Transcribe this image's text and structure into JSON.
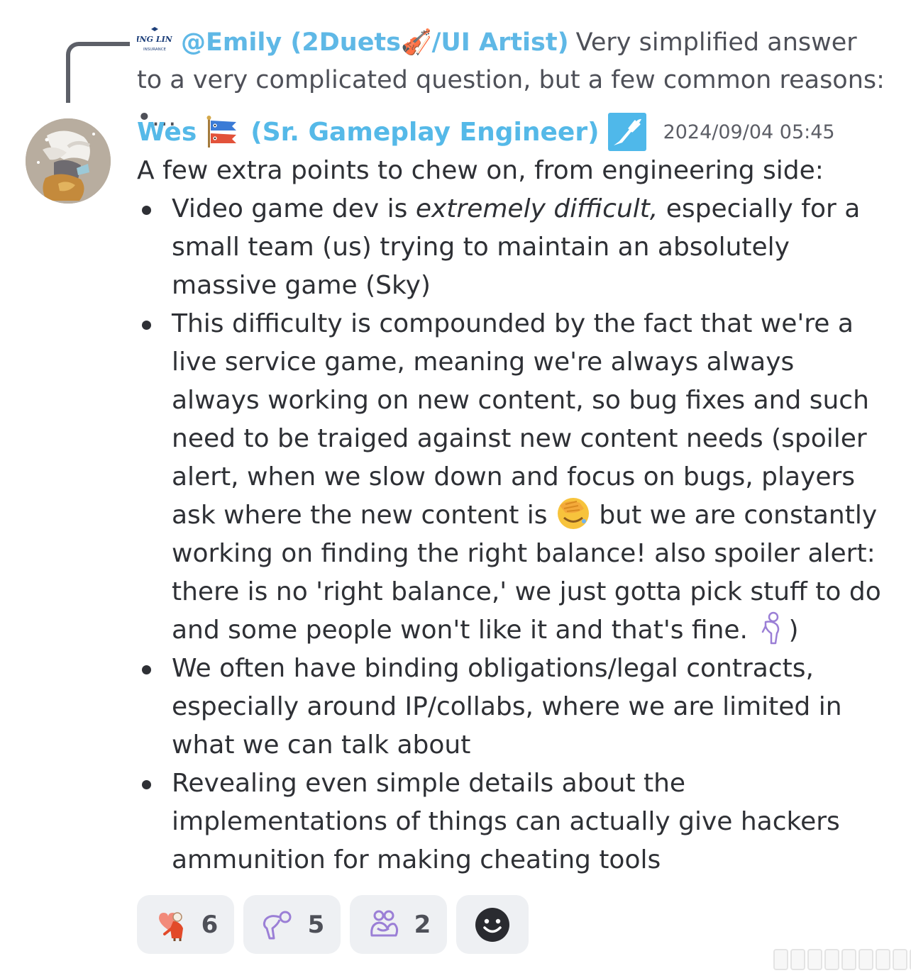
{
  "reply": {
    "author": "@Emily (2Duets🎻/UI Artist)",
    "preview": "Very simplified answer to a very complicated question, but a few common reasons: •…",
    "logo_text": "LING LING INSURANCE",
    "logo_top": "LING LING",
    "logo_bottom": "INSURANCE"
  },
  "message": {
    "author": "Wes",
    "role": "(Sr. Gameplay Engineer)",
    "timestamp": "2024/09/04 05:45",
    "intro": "A few extra points to chew on, from engineering side:",
    "bullets": [
      {
        "before": "Video game dev is ",
        "emphasis": "extremely difficult,",
        "after": " especially for a small team (us) trying to maintain an absolutely massive game (Sky)"
      },
      {
        "part1": "This difficulty is compounded by the fact that we're a live service game, meaning we're always always always working on new content, so bug fixes and such need to be traiged against new content needs (spoiler alert, when we slow down and focus on bugs, players ask where the new content is ",
        "part2": " but we are constantly working on finding the right balance! also spoiler alert: there is no 'right balance,' we just gotta pick stuff to do and some people won't like it and that's fine. ",
        "part3": ")"
      },
      {
        "text": "We often have binding obligations/legal contracts, especially around IP/collabs, where we are limited in what we can talk about"
      },
      {
        "text": "Revealing even simple details about the implementations of things can actually give hackers ammunition for making cheating tools"
      }
    ]
  },
  "reactions": [
    {
      "icon": "heart-character-emoji",
      "count": "6"
    },
    {
      "icon": "bow-emote-icon",
      "count": "5"
    },
    {
      "icon": "hug-emote-icon",
      "count": "2"
    }
  ],
  "add_reaction_icon": "smiley-icon",
  "colors": {
    "author": "#55b9e8",
    "text": "#2e3035",
    "muted": "#4e5058",
    "reaction_bg": "#eef0f3",
    "emote_stroke": "#9b7fd6"
  }
}
